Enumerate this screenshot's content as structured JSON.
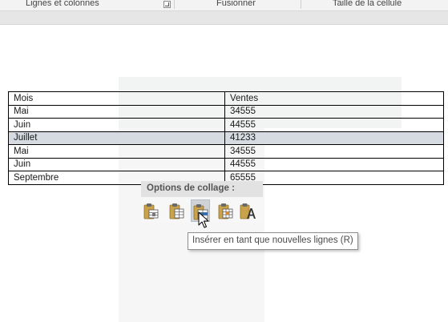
{
  "ribbon": {
    "groups": [
      {
        "label": "Lignes et colonnes"
      },
      {
        "label": "Fusionner"
      },
      {
        "label": "Taille de la cellule"
      }
    ]
  },
  "table": {
    "rows": [
      {
        "month": "Mois",
        "sales": "Ventes",
        "selected": false
      },
      {
        "month": "Mai",
        "sales": "34555",
        "selected": false
      },
      {
        "month": "Juin",
        "sales": "44555",
        "selected": false
      },
      {
        "month": "Juillet",
        "sales": "41233",
        "selected": true
      },
      {
        "month": "Mai",
        "sales": "34555",
        "selected": false
      },
      {
        "month": "Juin",
        "sales": "44555",
        "selected": false
      },
      {
        "month": "Septembre",
        "sales": "65555",
        "selected": false
      }
    ]
  },
  "paste_options": {
    "title": "Options de collage :",
    "buttons": [
      {
        "icon": "paste-nested-table-icon"
      },
      {
        "icon": "paste-merge-table-icon"
      },
      {
        "icon": "paste-insert-rows-icon",
        "hovered": true
      },
      {
        "icon": "paste-overwrite-cells-icon"
      },
      {
        "icon": "paste-text-only-icon"
      }
    ]
  },
  "tooltip": {
    "text": "Insérer en tant que nouvelles lignes (R)"
  },
  "colors": {
    "selected_row": "#d6dbe2",
    "clipboard": "#c9a24a",
    "accent_blue": "#3a6fb0"
  }
}
